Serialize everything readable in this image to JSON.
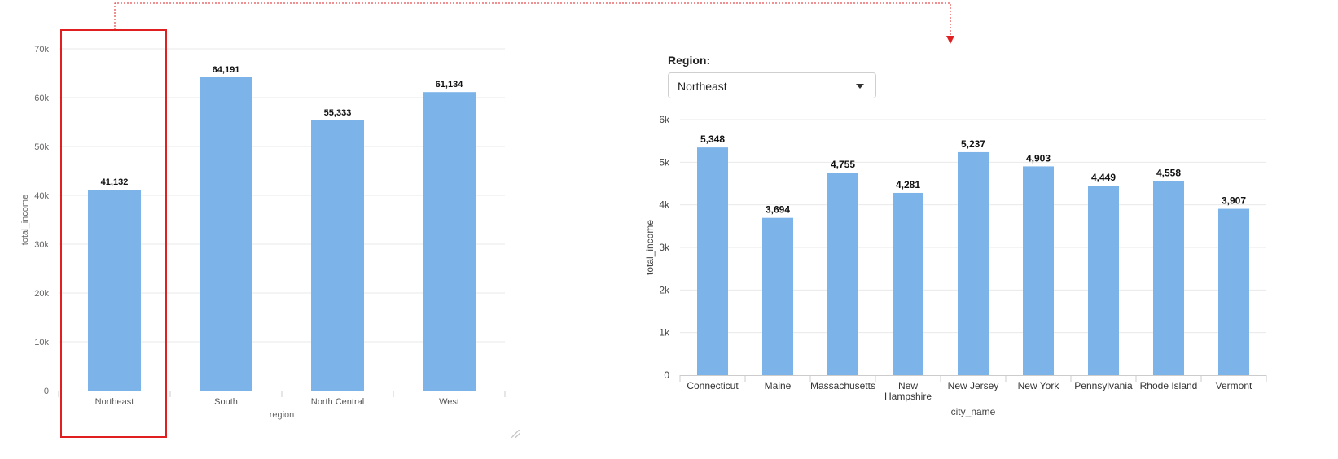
{
  "filter": {
    "label": "Region:",
    "selected": "Northeast"
  },
  "colors": {
    "bar": "#7cb4ea",
    "highlight": "#e02020",
    "grid": "#e9e9e9",
    "axis_text": "#666666"
  },
  "chart_data": [
    {
      "type": "bar",
      "categories": [
        "Northeast",
        "South",
        "North Central",
        "West"
      ],
      "values": [
        41132,
        64191,
        55333,
        61134
      ],
      "value_labels": [
        "41,132",
        "64,191",
        "55,333",
        "61,134"
      ],
      "xlabel": "region",
      "ylabel": "total_income",
      "ylim": [
        0,
        70000
      ],
      "y_ticks": [
        "0",
        "10k",
        "20k",
        "30k",
        "40k",
        "50k",
        "60k",
        "70k"
      ],
      "y_tick_values": [
        0,
        10000,
        20000,
        30000,
        40000,
        50000,
        60000,
        70000
      ],
      "highlighted_category": "Northeast",
      "grid": true
    },
    {
      "type": "bar",
      "categories": [
        "Connecticut",
        "Maine",
        "Massachusetts",
        "New Hampshire",
        "New Jersey",
        "New York",
        "Pennsylvania",
        "Rhode Island",
        "Vermont"
      ],
      "values": [
        5348,
        3694,
        4755,
        4281,
        5237,
        4903,
        4449,
        4558,
        3907
      ],
      "value_labels": [
        "5,348",
        "3,694",
        "4,755",
        "4,281",
        "5,237",
        "4,903",
        "4,449",
        "4,558",
        "3,907"
      ],
      "xlabel": "city_name",
      "ylabel": "total_income",
      "ylim": [
        0,
        6000
      ],
      "y_ticks": [
        "0",
        "1k",
        "2k",
        "3k",
        "4k",
        "5k",
        "6k"
      ],
      "y_tick_values": [
        0,
        1000,
        2000,
        3000,
        4000,
        5000,
        6000
      ],
      "grid": true
    }
  ]
}
